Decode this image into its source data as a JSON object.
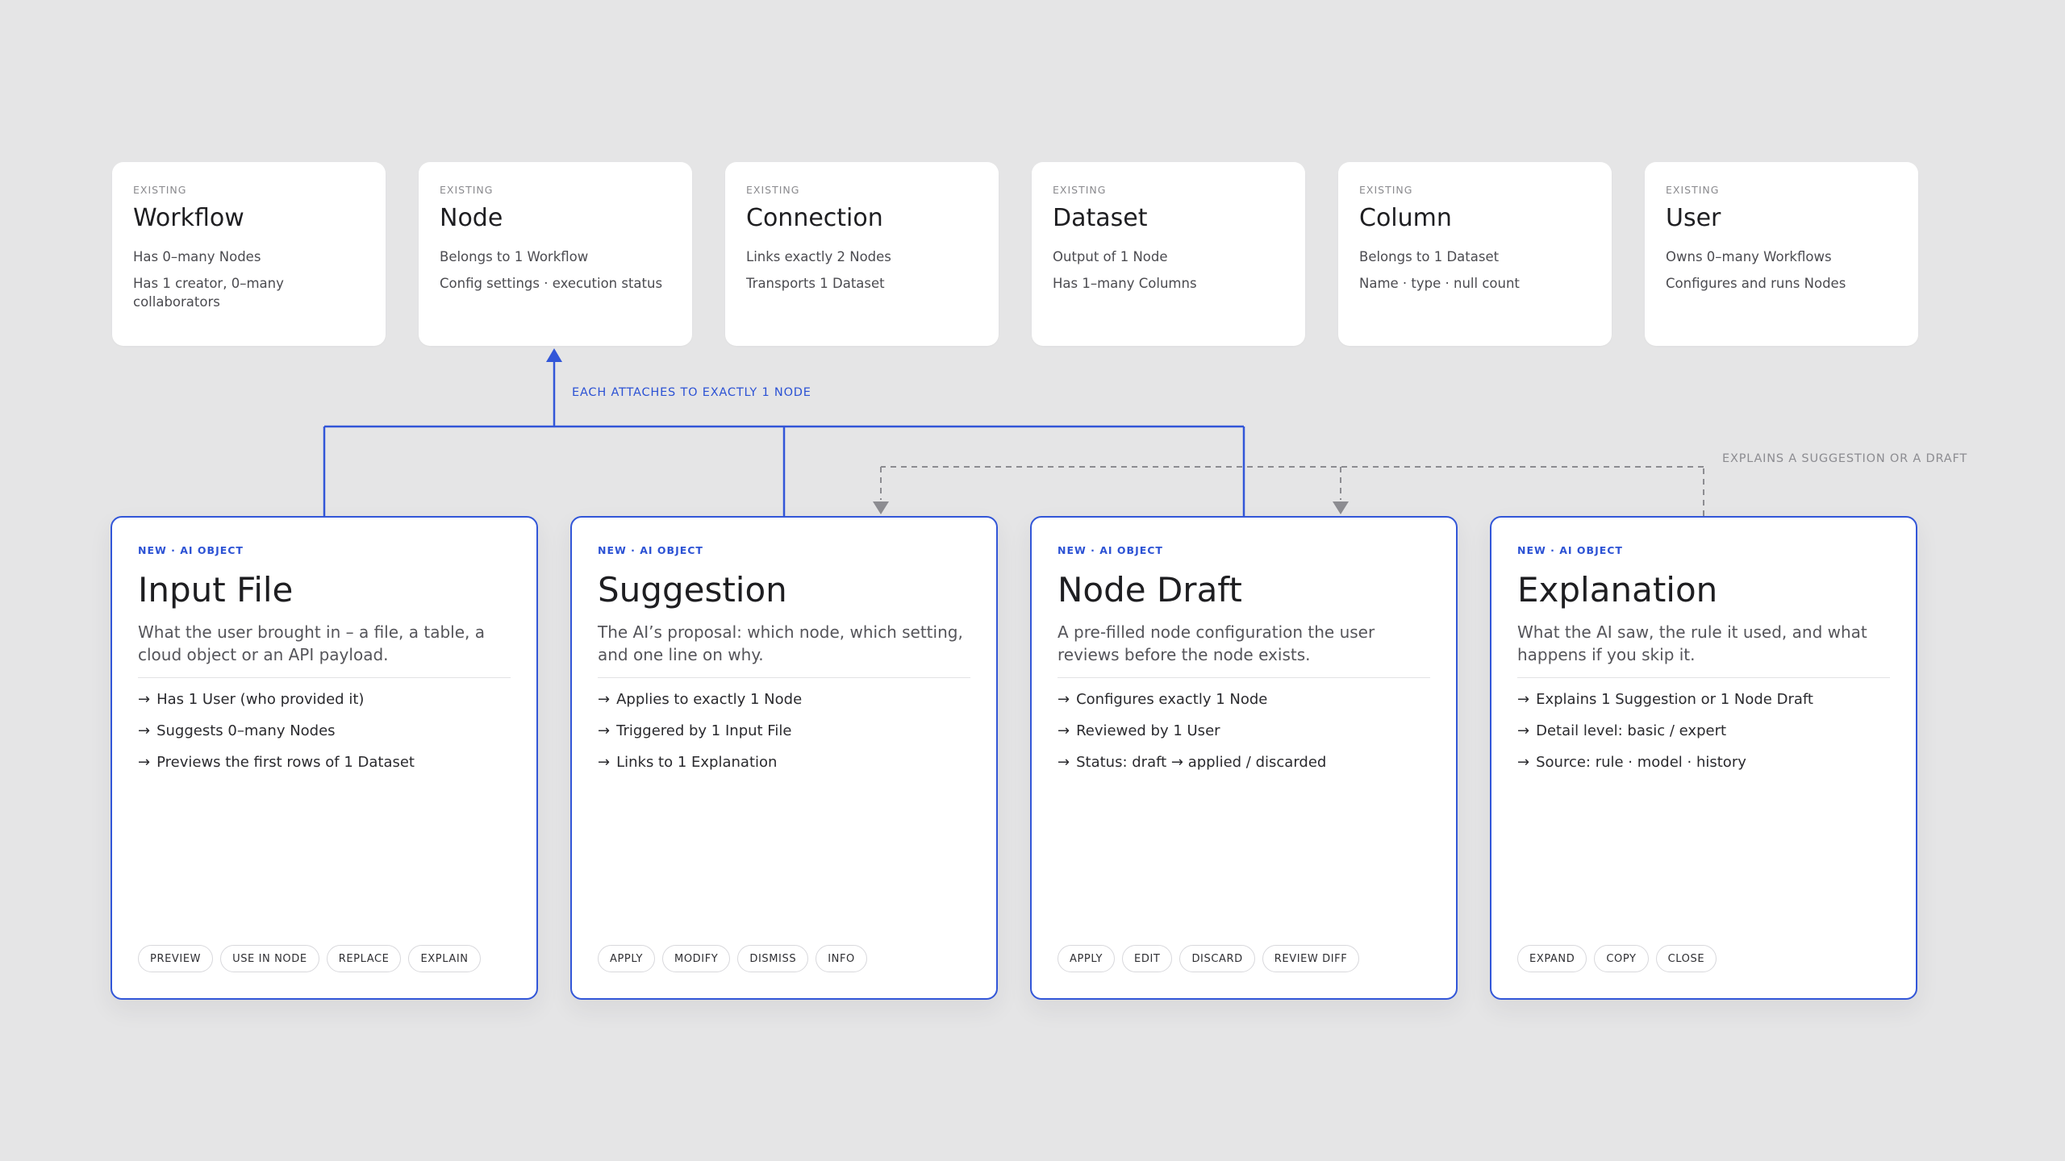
{
  "existing_entities": [
    {
      "tag": "EXISTING",
      "title": "Workflow",
      "lines": [
        "Has 0–many Nodes",
        "Has 1 creator, 0–many collaborators"
      ]
    },
    {
      "tag": "EXISTING",
      "title": "Node",
      "lines": [
        "Belongs to 1 Workflow",
        "Config settings · execution status"
      ]
    },
    {
      "tag": "EXISTING",
      "title": "Connection",
      "lines": [
        "Links exactly 2 Nodes",
        "Transports 1 Dataset"
      ]
    },
    {
      "tag": "EXISTING",
      "title": "Dataset",
      "lines": [
        "Output of 1 Node",
        "Has 1–many Columns"
      ]
    },
    {
      "tag": "EXISTING",
      "title": "Column",
      "lines": [
        "Belongs to 1 Dataset",
        "Name · type · null count"
      ]
    },
    {
      "tag": "EXISTING",
      "title": "User",
      "lines": [
        "Owns 0–many Workflows",
        "Configures and runs Nodes"
      ]
    }
  ],
  "connectors": {
    "attach_label": "EACH ATTACHES TO EXACTLY 1 NODE",
    "explains_label": "EXPLAINS A SUGGESTION OR A DRAFT"
  },
  "ai_objects": [
    {
      "tag": "NEW · AI OBJECT",
      "title": "Input File",
      "description": "What the user brought in – a file, a table, a cloud object or an API payload.",
      "relations": [
        "Has 1 User (who provided it)",
        "Suggests 0–many Nodes",
        "Previews the first rows of 1 Dataset"
      ],
      "actions": [
        "PREVIEW",
        "USE IN NODE",
        "REPLACE",
        "EXPLAIN"
      ]
    },
    {
      "tag": "NEW · AI OBJECT",
      "title": "Suggestion",
      "description": "The AI’s proposal: which node, which setting, and one line on why.",
      "relations": [
        "Applies to exactly 1 Node",
        "Triggered by 1 Input File",
        "Links to 1 Explanation"
      ],
      "actions": [
        "APPLY",
        "MODIFY",
        "DISMISS",
        "INFO"
      ]
    },
    {
      "tag": "NEW · AI OBJECT",
      "title": "Node Draft",
      "description": "A pre-filled node configuration the user reviews before the node exists.",
      "relations": [
        "Configures exactly 1 Node",
        "Reviewed by 1 User",
        "Status: draft → applied / discarded"
      ],
      "actions": [
        "APPLY",
        "EDIT",
        "DISCARD",
        "REVIEW DIFF"
      ]
    },
    {
      "tag": "NEW · AI OBJECT",
      "title": "Explanation",
      "description": "What the AI saw, the rule it used, and what happens if you skip it.",
      "relations": [
        "Explains 1 Suggestion or 1 Node Draft",
        "Detail level: basic / expert",
        "Source: rule · model · history"
      ],
      "actions": [
        "EXPAND",
        "COPY",
        "CLOSE"
      ]
    }
  ],
  "relation_arrow": "→",
  "colors": {
    "background": "#e5e5e6",
    "accent": "#3256d8",
    "dashed_connector": "#8c8c91",
    "card": "#ffffff"
  }
}
